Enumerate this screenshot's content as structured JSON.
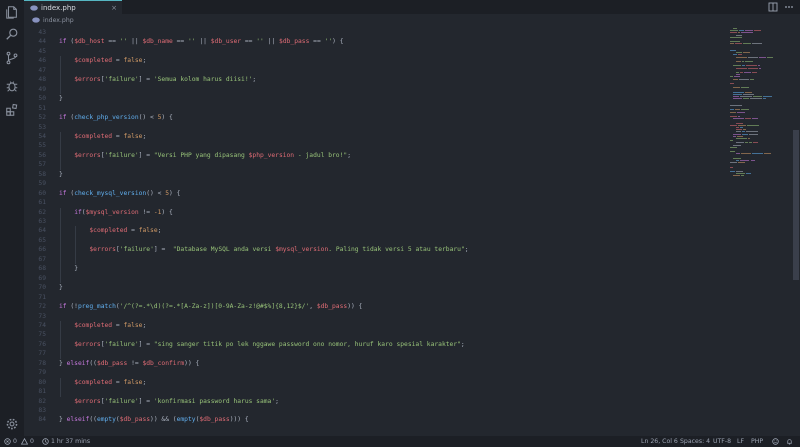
{
  "tab": {
    "label": "index.php",
    "close": "×"
  },
  "breadcrumb": {
    "file": "index.php"
  },
  "editor": {
    "lines": [
      {
        "n": "43",
        "indent": 0,
        "tokens": []
      },
      {
        "n": "44",
        "indent": 0,
        "tokens": [
          {
            "t": "k",
            "s": "if"
          },
          {
            "t": "p",
            "s": " ("
          },
          {
            "t": "v",
            "s": "$db_host"
          },
          {
            "t": "p",
            "s": " == "
          },
          {
            "t": "s",
            "s": "''"
          },
          {
            "t": "p",
            "s": " || "
          },
          {
            "t": "v",
            "s": "$db_name"
          },
          {
            "t": "p",
            "s": " == "
          },
          {
            "t": "s",
            "s": "''"
          },
          {
            "t": "p",
            "s": " || "
          },
          {
            "t": "v",
            "s": "$db_user"
          },
          {
            "t": "p",
            "s": " == "
          },
          {
            "t": "s",
            "s": "''"
          },
          {
            "t": "p",
            "s": " || "
          },
          {
            "t": "v",
            "s": "$db_pass"
          },
          {
            "t": "p",
            "s": " == "
          },
          {
            "t": "s",
            "s": "''"
          },
          {
            "t": "p",
            "s": ") {"
          }
        ]
      },
      {
        "n": "45",
        "indent": 0,
        "tokens": []
      },
      {
        "n": "46",
        "indent": 1,
        "tokens": [
          {
            "t": "v",
            "s": "$completed"
          },
          {
            "t": "p",
            "s": " = "
          },
          {
            "t": "n",
            "s": "false"
          },
          {
            "t": "p",
            "s": ";"
          }
        ]
      },
      {
        "n": "47",
        "indent": 0,
        "tokens": []
      },
      {
        "n": "48",
        "indent": 1,
        "tokens": [
          {
            "t": "v",
            "s": "$errors"
          },
          {
            "t": "p",
            "s": "["
          },
          {
            "t": "s",
            "s": "'failure'"
          },
          {
            "t": "p",
            "s": "] = "
          },
          {
            "t": "s",
            "s": "'Semua kolom harus diisi!'"
          },
          {
            "t": "p",
            "s": ";"
          }
        ]
      },
      {
        "n": "49",
        "indent": 0,
        "tokens": []
      },
      {
        "n": "50",
        "indent": 0,
        "tokens": [
          {
            "t": "p",
            "s": "}"
          }
        ]
      },
      {
        "n": "51",
        "indent": 0,
        "tokens": []
      },
      {
        "n": "52",
        "indent": 0,
        "tokens": [
          {
            "t": "k",
            "s": "if"
          },
          {
            "t": "p",
            "s": " ("
          },
          {
            "t": "f",
            "s": "check_php_version"
          },
          {
            "t": "p",
            "s": "() < "
          },
          {
            "t": "n",
            "s": "5"
          },
          {
            "t": "p",
            "s": ") {"
          }
        ]
      },
      {
        "n": "53",
        "indent": 0,
        "tokens": []
      },
      {
        "n": "54",
        "indent": 1,
        "tokens": [
          {
            "t": "v",
            "s": "$completed"
          },
          {
            "t": "p",
            "s": " = "
          },
          {
            "t": "n",
            "s": "false"
          },
          {
            "t": "p",
            "s": ";"
          }
        ]
      },
      {
        "n": "55",
        "indent": 0,
        "tokens": []
      },
      {
        "n": "56",
        "indent": 1,
        "tokens": [
          {
            "t": "v",
            "s": "$errors"
          },
          {
            "t": "p",
            "s": "["
          },
          {
            "t": "s",
            "s": "'failure'"
          },
          {
            "t": "p",
            "s": "] = "
          },
          {
            "t": "s",
            "s": "\"Versi PHP yang dipasang "
          },
          {
            "t": "v",
            "s": "$php_version"
          },
          {
            "t": "s",
            "s": " - jadul bro!\""
          },
          {
            "t": "p",
            "s": ";"
          }
        ]
      },
      {
        "n": "57",
        "indent": 0,
        "tokens": []
      },
      {
        "n": "58",
        "indent": 0,
        "tokens": [
          {
            "t": "p",
            "s": "}"
          }
        ]
      },
      {
        "n": "59",
        "indent": 0,
        "tokens": []
      },
      {
        "n": "60",
        "indent": 0,
        "tokens": [
          {
            "t": "k",
            "s": "if"
          },
          {
            "t": "p",
            "s": " ("
          },
          {
            "t": "f",
            "s": "check_mysql_version"
          },
          {
            "t": "p",
            "s": "() < "
          },
          {
            "t": "n",
            "s": "5"
          },
          {
            "t": "p",
            "s": ") {"
          }
        ]
      },
      {
        "n": "61",
        "indent": 0,
        "tokens": []
      },
      {
        "n": "62",
        "indent": 1,
        "tokens": [
          {
            "t": "k",
            "s": "if"
          },
          {
            "t": "p",
            "s": "("
          },
          {
            "t": "v",
            "s": "$mysql_version"
          },
          {
            "t": "p",
            "s": " != "
          },
          {
            "t": "n",
            "s": "-1"
          },
          {
            "t": "p",
            "s": ") {"
          }
        ]
      },
      {
        "n": "63",
        "indent": 0,
        "tokens": []
      },
      {
        "n": "64",
        "indent": 2,
        "tokens": [
          {
            "t": "v",
            "s": "$completed"
          },
          {
            "t": "p",
            "s": " = "
          },
          {
            "t": "n",
            "s": "false"
          },
          {
            "t": "p",
            "s": ";"
          }
        ]
      },
      {
        "n": "65",
        "indent": 0,
        "tokens": []
      },
      {
        "n": "66",
        "indent": 2,
        "tokens": [
          {
            "t": "v",
            "s": "$errors"
          },
          {
            "t": "p",
            "s": "["
          },
          {
            "t": "s",
            "s": "'failure'"
          },
          {
            "t": "p",
            "s": "] =  "
          },
          {
            "t": "s",
            "s": "\"Database MySQL anda versi "
          },
          {
            "t": "v",
            "s": "$mysql_version"
          },
          {
            "t": "s",
            "s": ". Paling tidak versi 5 atau terbaru\""
          },
          {
            "t": "p",
            "s": ";"
          }
        ]
      },
      {
        "n": "67",
        "indent": 0,
        "tokens": []
      },
      {
        "n": "68",
        "indent": 1,
        "tokens": [
          {
            "t": "p",
            "s": "}"
          }
        ]
      },
      {
        "n": "69",
        "indent": 0,
        "tokens": []
      },
      {
        "n": "70",
        "indent": 0,
        "tokens": [
          {
            "t": "p",
            "s": "}"
          }
        ]
      },
      {
        "n": "71",
        "indent": 0,
        "tokens": []
      },
      {
        "n": "72",
        "indent": 0,
        "tokens": [
          {
            "t": "k",
            "s": "if"
          },
          {
            "t": "p",
            "s": " (!"
          },
          {
            "t": "f",
            "s": "preg_match"
          },
          {
            "t": "p",
            "s": "("
          },
          {
            "t": "s",
            "s": "'/^(?=.*\\d)(?=.*[A-Za-z])[0-9A-Za-z!@#$%]{8,12}$/'"
          },
          {
            "t": "p",
            "s": ", "
          },
          {
            "t": "v",
            "s": "$db_pass"
          },
          {
            "t": "p",
            "s": ")) {"
          }
        ]
      },
      {
        "n": "73",
        "indent": 0,
        "tokens": []
      },
      {
        "n": "74",
        "indent": 1,
        "tokens": [
          {
            "t": "v",
            "s": "$completed"
          },
          {
            "t": "p",
            "s": " = "
          },
          {
            "t": "n",
            "s": "false"
          },
          {
            "t": "p",
            "s": ";"
          }
        ]
      },
      {
        "n": "75",
        "indent": 0,
        "tokens": []
      },
      {
        "n": "76",
        "indent": 1,
        "tokens": [
          {
            "t": "v",
            "s": "$errors"
          },
          {
            "t": "p",
            "s": "["
          },
          {
            "t": "s",
            "s": "'failure'"
          },
          {
            "t": "p",
            "s": "] = "
          },
          {
            "t": "s",
            "s": "\"sing sanger titik po lek nggawe password ono nomor, huruf karo spesial karakter\""
          },
          {
            "t": "p",
            "s": ";"
          }
        ]
      },
      {
        "n": "77",
        "indent": 0,
        "tokens": []
      },
      {
        "n": "78",
        "indent": 0,
        "tokens": [
          {
            "t": "p",
            "s": "} "
          },
          {
            "t": "k",
            "s": "elseif"
          },
          {
            "t": "p",
            "s": "(("
          },
          {
            "t": "v",
            "s": "$db_pass"
          },
          {
            "t": "p",
            "s": " != "
          },
          {
            "t": "v",
            "s": "$db_confirm"
          },
          {
            "t": "p",
            "s": ")) {"
          }
        ]
      },
      {
        "n": "79",
        "indent": 0,
        "tokens": []
      },
      {
        "n": "80",
        "indent": 1,
        "tokens": [
          {
            "t": "v",
            "s": "$completed"
          },
          {
            "t": "p",
            "s": " = "
          },
          {
            "t": "n",
            "s": "false"
          },
          {
            "t": "p",
            "s": ";"
          }
        ]
      },
      {
        "n": "81",
        "indent": 0,
        "tokens": []
      },
      {
        "n": "82",
        "indent": 1,
        "tokens": [
          {
            "t": "v",
            "s": "$errors"
          },
          {
            "t": "p",
            "s": "["
          },
          {
            "t": "s",
            "s": "'failure'"
          },
          {
            "t": "p",
            "s": "] = "
          },
          {
            "t": "s",
            "s": "'konfirmasi password harus sama'"
          },
          {
            "t": "p",
            "s": ";"
          }
        ]
      },
      {
        "n": "83",
        "indent": 0,
        "tokens": []
      },
      {
        "n": "84",
        "indent": 0,
        "tokens": [
          {
            "t": "p",
            "s": "} "
          },
          {
            "t": "k",
            "s": "elseif"
          },
          {
            "t": "p",
            "s": "(("
          },
          {
            "t": "f",
            "s": "empty"
          },
          {
            "t": "p",
            "s": "("
          },
          {
            "t": "v",
            "s": "$db_pass"
          },
          {
            "t": "p",
            "s": ")) && ("
          },
          {
            "t": "f",
            "s": "empty"
          },
          {
            "t": "p",
            "s": "("
          },
          {
            "t": "v",
            "s": "$db_pass"
          },
          {
            "t": "p",
            "s": "))) {"
          }
        ]
      }
    ]
  },
  "statusbar": {
    "errors": "0",
    "warnings": "0",
    "time": "1 hr 37 mins",
    "position": "Ln 26, Col 6",
    "spaces": "Spaces: 4",
    "encoding": "UTF-8",
    "eol": "LF",
    "language": "PHP"
  },
  "colors": {
    "keyword": "#c678dd",
    "variable": "#e06c75",
    "string": "#98c379",
    "number": "#d19a66",
    "function": "#61afef",
    "tab_accent": "#56b6c2"
  },
  "icons": [
    "files-icon",
    "search-icon",
    "source-control-icon",
    "debug-icon",
    "extensions-icon",
    "settings-gear-icon",
    "php-file-icon",
    "split-editor-icon",
    "more-actions-icon",
    "error-icon",
    "warning-icon",
    "clock-icon",
    "feedback-icon",
    "bell-icon"
  ]
}
